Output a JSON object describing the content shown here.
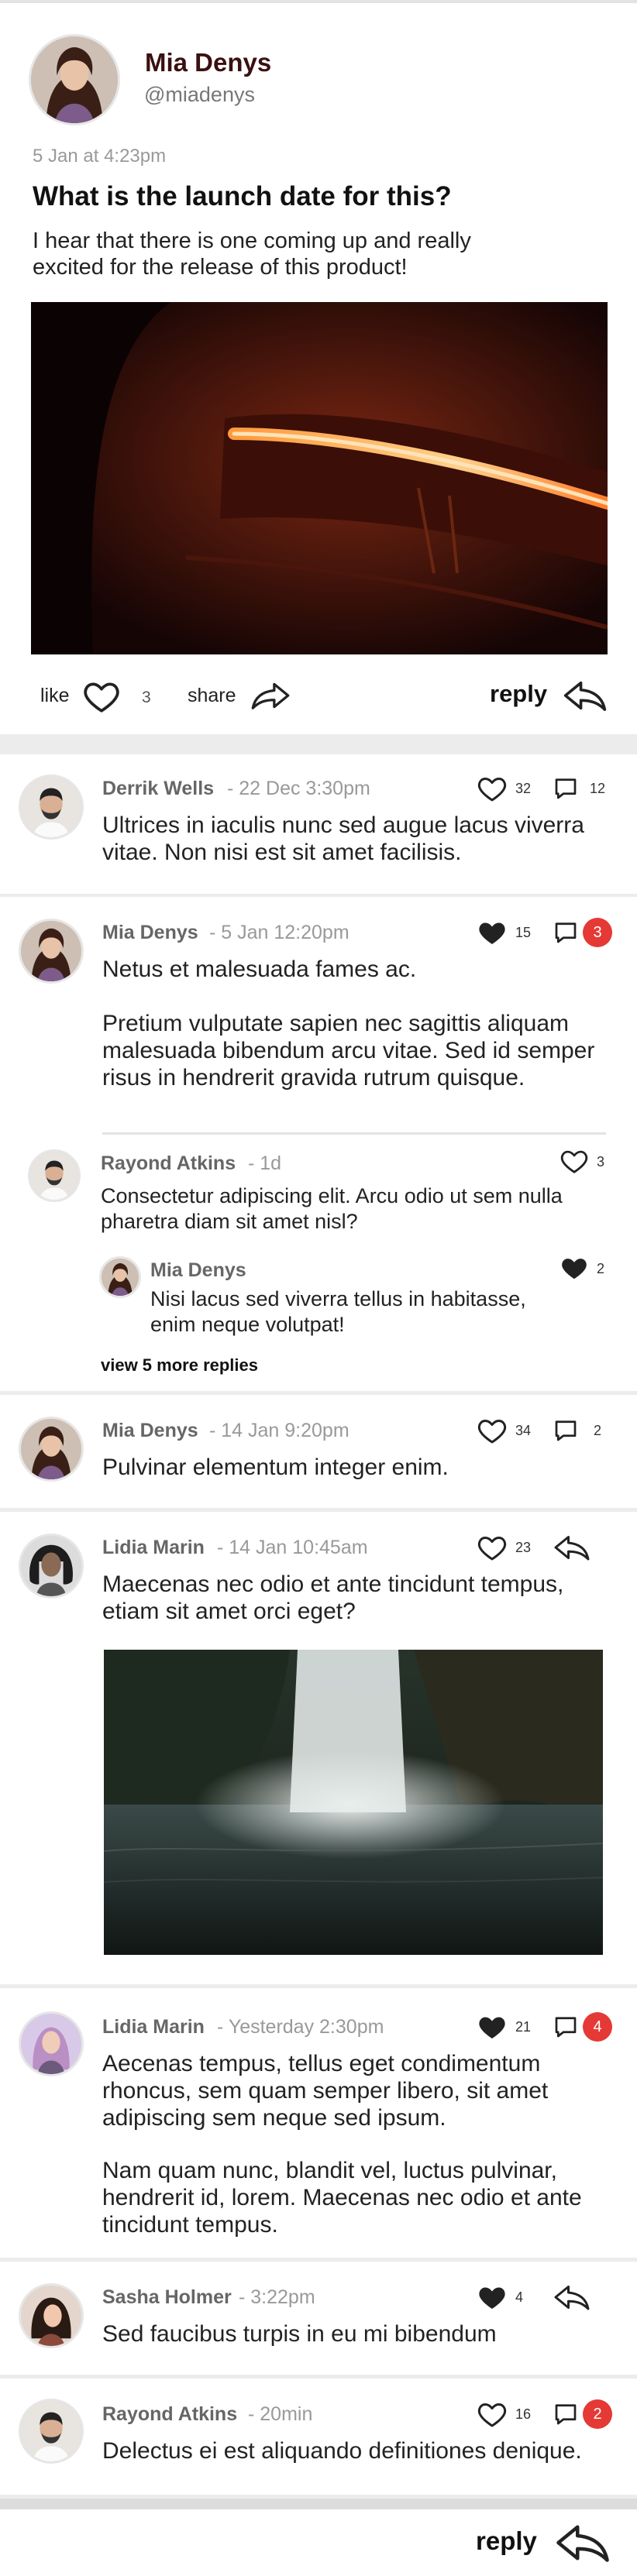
{
  "post": {
    "author": "Mia Denys",
    "handle": "@miadenys",
    "timestamp": "5 Jan at 4:23pm",
    "title": "What is the launch date for this?",
    "body": "I hear that there is one coming up and really excited for the release of this product!",
    "like_label": "like",
    "like_count": "3",
    "share_label": "share",
    "reply_label": "reply"
  },
  "comments": [
    {
      "author": "Derrik Wells",
      "time": "- 22 Dec 3:30pm",
      "body": "Ultrices in iaculis nunc sed augue lacus viverra vitae. Non nisi est sit amet facilisis.",
      "likes": "32",
      "replies": "12"
    },
    {
      "author": "Mia Denys",
      "time": "- 5 Jan 12:20pm",
      "body1": "Netus et malesuada fames ac.",
      "body2": "Pretium vulputate sapien nec sagittis aliquam malesuada bibendum arcu vitae. Sed id semper risus in hendrerit gravida rutrum quisque.",
      "likes": "15",
      "replies": "3",
      "thread": [
        {
          "author": "Rayond Atkins",
          "time": "- 1d",
          "body": "Consectetur adipiscing elit. Arcu odio ut sem nulla pharetra diam sit amet nisl?",
          "likes": "3"
        },
        {
          "author": "Mia Denys",
          "body": "Nisi lacus sed viverra tellus in habitasse, enim neque volutpat!",
          "likes": "2"
        }
      ],
      "more_replies": "view 5 more replies"
    },
    {
      "author": "Mia Denys",
      "time": "- 14 Jan 9:20pm",
      "body": "Pulvinar elementum integer enim.",
      "likes": "34",
      "replies": "2"
    },
    {
      "author": "Lidia Marin",
      "time": "- 14 Jan 10:45am",
      "body": "Maecenas nec odio et ante tincidunt tempus, etiam sit amet orci eget?",
      "likes": "23"
    },
    {
      "author": "Lidia Marin",
      "time": "- Yesterday 2:30pm",
      "body1": "Aecenas tempus, tellus eget condimentum rhoncus, sem quam semper libero, sit amet adipiscing sem neque sed ipsum.",
      "body2": "Nam quam nunc, blandit vel, luctus pulvinar, hendrerit id, lorem. Maecenas nec odio et ante tincidunt tempus.",
      "likes": "21",
      "replies": "4"
    },
    {
      "author": "Sasha Holmer",
      "time": "- 3:22pm",
      "body": "Sed faucibus turpis in eu mi bibendum",
      "likes": "4"
    },
    {
      "author": "Rayond Atkins",
      "time": "- 20min",
      "body": "Delectus ei est aliquando definitiones denique.",
      "likes": "16",
      "replies": "2"
    }
  ],
  "footer": {
    "reply_label": "reply"
  },
  "colors": {
    "accent": "#e53935",
    "divider": "#e3e3e3",
    "name": "#666666",
    "meta": "#999999"
  }
}
